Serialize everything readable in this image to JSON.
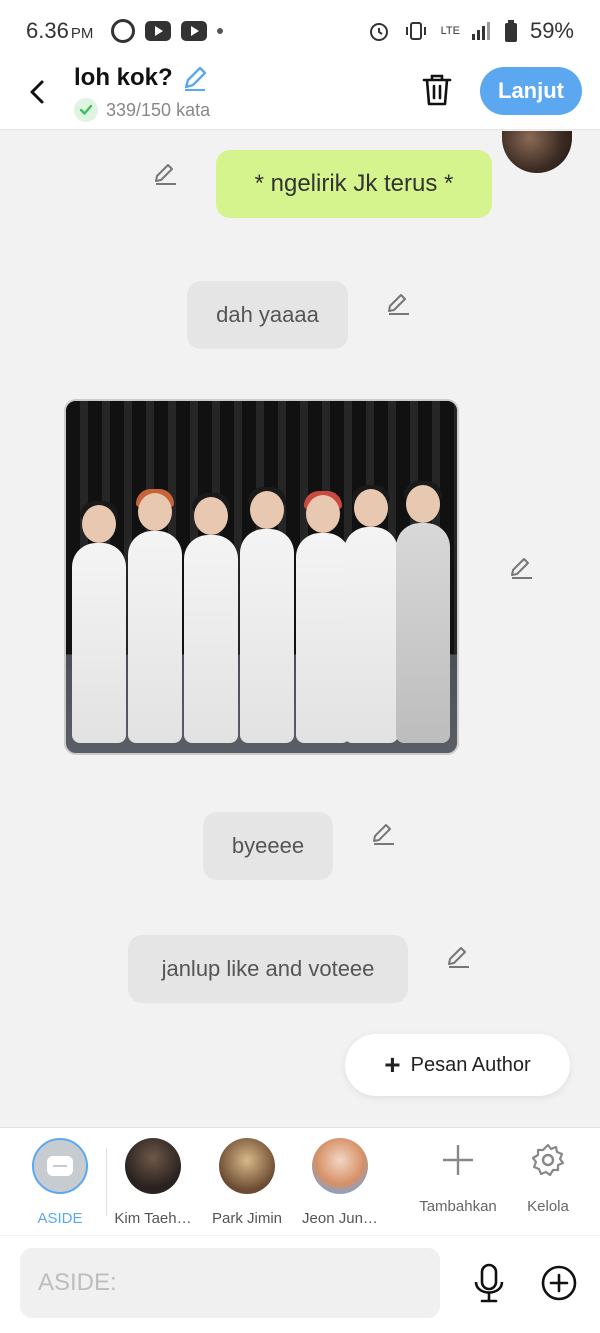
{
  "status": {
    "time": "6.36",
    "ampm": "PM",
    "network": "LTE",
    "battery": "59%"
  },
  "header": {
    "title": "loh kok?",
    "word_count": "339/150 kata",
    "next_label": "Lanjut"
  },
  "messages": [
    {
      "sender": "me",
      "text": "* ngelirik Jk terus *"
    },
    {
      "sender": "other",
      "text": "dah yaaaa"
    },
    {
      "sender": "other",
      "type": "image",
      "text": ""
    },
    {
      "sender": "other",
      "text": "byeeee"
    },
    {
      "sender": "other",
      "text": "janlup like and voteee"
    }
  ],
  "author_button": {
    "label": "Pesan Author"
  },
  "characters": [
    {
      "name": "ASIDE",
      "selected": true
    },
    {
      "name": "Kim Taeh…"
    },
    {
      "name": "Park Jimin"
    },
    {
      "name": "Jeon Jun…"
    }
  ],
  "tools": {
    "add_label": "Tambahkan",
    "manage_label": "Kelola"
  },
  "composer": {
    "placeholder": "ASIDE:"
  },
  "colors": {
    "accent": "#5ba8f0",
    "my_bubble": "#d5f48d",
    "other_bubble": "#e5e5e5"
  }
}
